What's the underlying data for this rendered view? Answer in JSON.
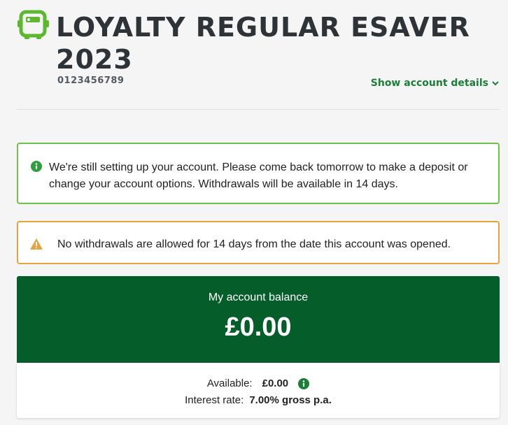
{
  "account": {
    "title": "LOYALTY REGULAR ESAVER 2023",
    "number": "0123456789",
    "show_details_label": "Show account details"
  },
  "alerts": {
    "info_text": "We're still setting up your account. Please come back tomorrow to make a deposit or change your account options. Withdrawals will be available in 14 days.",
    "warning_text": "No withdrawals are allowed for 14 days from the date this account was opened."
  },
  "balance": {
    "label": "My account balance",
    "amount": "£0.00",
    "available_label": "Available:",
    "available_value": "£0.00",
    "interest_label": "Interest rate:",
    "interest_value": "7.00% gross p.a."
  },
  "colors": {
    "brand_green": "#055d2a",
    "accent_green": "#1a7f37",
    "info_border": "#6cc24a",
    "warning_border": "#e8a33d"
  },
  "icons": [
    "piggy-bank-icon",
    "chevron-down-icon",
    "info-icon",
    "warning-icon"
  ]
}
